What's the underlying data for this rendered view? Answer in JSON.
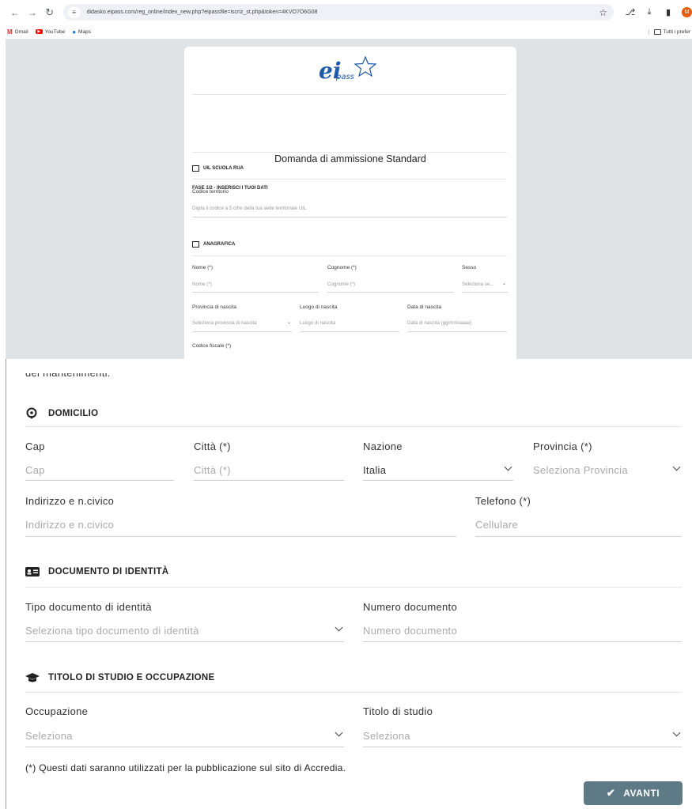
{
  "browser": {
    "url": "didasko.eipass.com/reg_online/index_new.php?eipassfile=iscriz_st.php&token=4KVO7O6G08",
    "avatar_initial": "M",
    "bookmarks": [
      {
        "label": "Gmail",
        "icon": "gmail-icon"
      },
      {
        "label": "YouTube",
        "icon": "youtube-icon"
      },
      {
        "label": "Maps",
        "icon": "maps-icon"
      }
    ],
    "bookmarks_right": "Tutti i prefer"
  },
  "card": {
    "logo_main": "ei",
    "logo_sub": "pass",
    "title": "Domanda di ammissione Standard",
    "fase": "FASE 1/2 - INSERISCI I TUOI DATI",
    "uil": {
      "section": "UIL SCUOLA RUA",
      "codice_label": "Codice territorio",
      "codice_placeholder": "Digita il codice a 5 cifre della tua sede territoriale UIL"
    },
    "anagrafica": {
      "section": "ANAGRAFICA",
      "nome_label": "Nome (*)",
      "nome_placeholder": "Nome  (*)",
      "cognome_label": "Cognome (*)",
      "cognome_placeholder": "Cognome (*)",
      "sesso_label": "Sesso",
      "sesso_placeholder": "Seleziona se...",
      "provincia_label": "Provincia di nascita",
      "provincia_placeholder": "Seleziona provincia di nascita",
      "luogo_label": "Luogo di nascita",
      "luogo_placeholder": "Luogo di nascita",
      "data_label": "Data di nascita",
      "data_placeholder": "Data di nascita (gg/mm/aaaa)",
      "cf_label": "Codice fiscale (*)"
    }
  },
  "form": {
    "cut_text": "dei mantenimenti.",
    "domicilio": {
      "section": "DOMICILIO",
      "cap_label": "Cap",
      "cap_placeholder": "Cap",
      "citta_label": "Città (*)",
      "citta_placeholder": "Città  (*)",
      "nazione_label": "Nazione",
      "nazione_value": "Italia",
      "provincia_label": "Provincia (*)",
      "provincia_placeholder": "Seleziona Provincia",
      "indirizzo_label": "Indirizzo e n.civico",
      "indirizzo_placeholder": "Indirizzo e n.civico",
      "telefono_label": "Telefono (*)",
      "telefono_placeholder": "Cellulare"
    },
    "documento": {
      "section": "DOCUMENTO DI IDENTITÀ",
      "tipo_label": "Tipo documento di identità",
      "tipo_placeholder": "Seleziona tipo documento di identità",
      "numero_label": "Numero documento",
      "numero_placeholder": "Numero documento"
    },
    "titolo": {
      "section": "TITOLO DI STUDIO E OCCUPAZIONE",
      "occupazione_label": "Occupazione",
      "occupazione_placeholder": "Seleziona",
      "titolo_label": "Titolo di studio",
      "titolo_placeholder": "Seleziona"
    },
    "note": "(*) Questi dati saranno utilizzati per la pubblicazione sul sito di Accredia.",
    "avanti_label": "AVANTI"
  }
}
